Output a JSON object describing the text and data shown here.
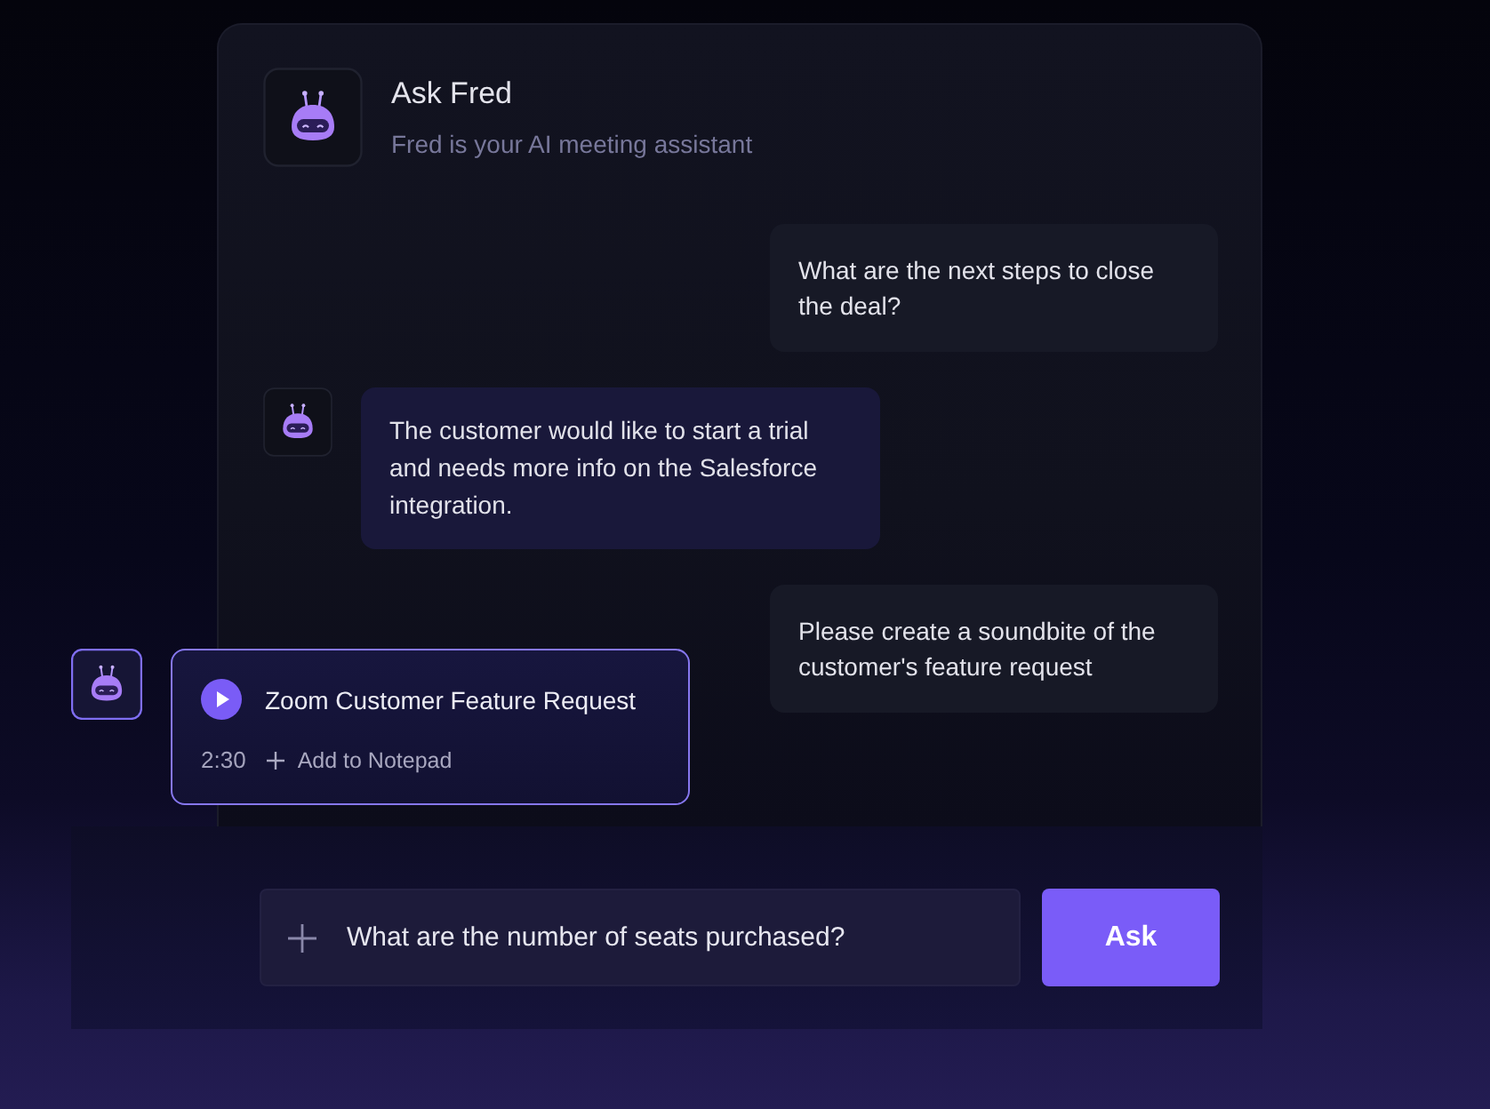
{
  "assistant": {
    "name": "Ask Fred",
    "tagline": "Fred is your AI meeting assistant"
  },
  "messages": [
    {
      "kind": "user",
      "text": "What are the next steps to close the deal?"
    },
    {
      "kind": "assistant",
      "text": "The customer would like to start a trial and needs more info on the Salesforce integration."
    },
    {
      "kind": "user",
      "text": "Please create a soundbite of the customer's feature request"
    }
  ],
  "soundbite": {
    "title": "Zoom Customer Feature Request",
    "duration": "2:30",
    "action": "Add to Notepad"
  },
  "composer": {
    "value": "What are the number of seats purchased?",
    "button": "Ask"
  }
}
